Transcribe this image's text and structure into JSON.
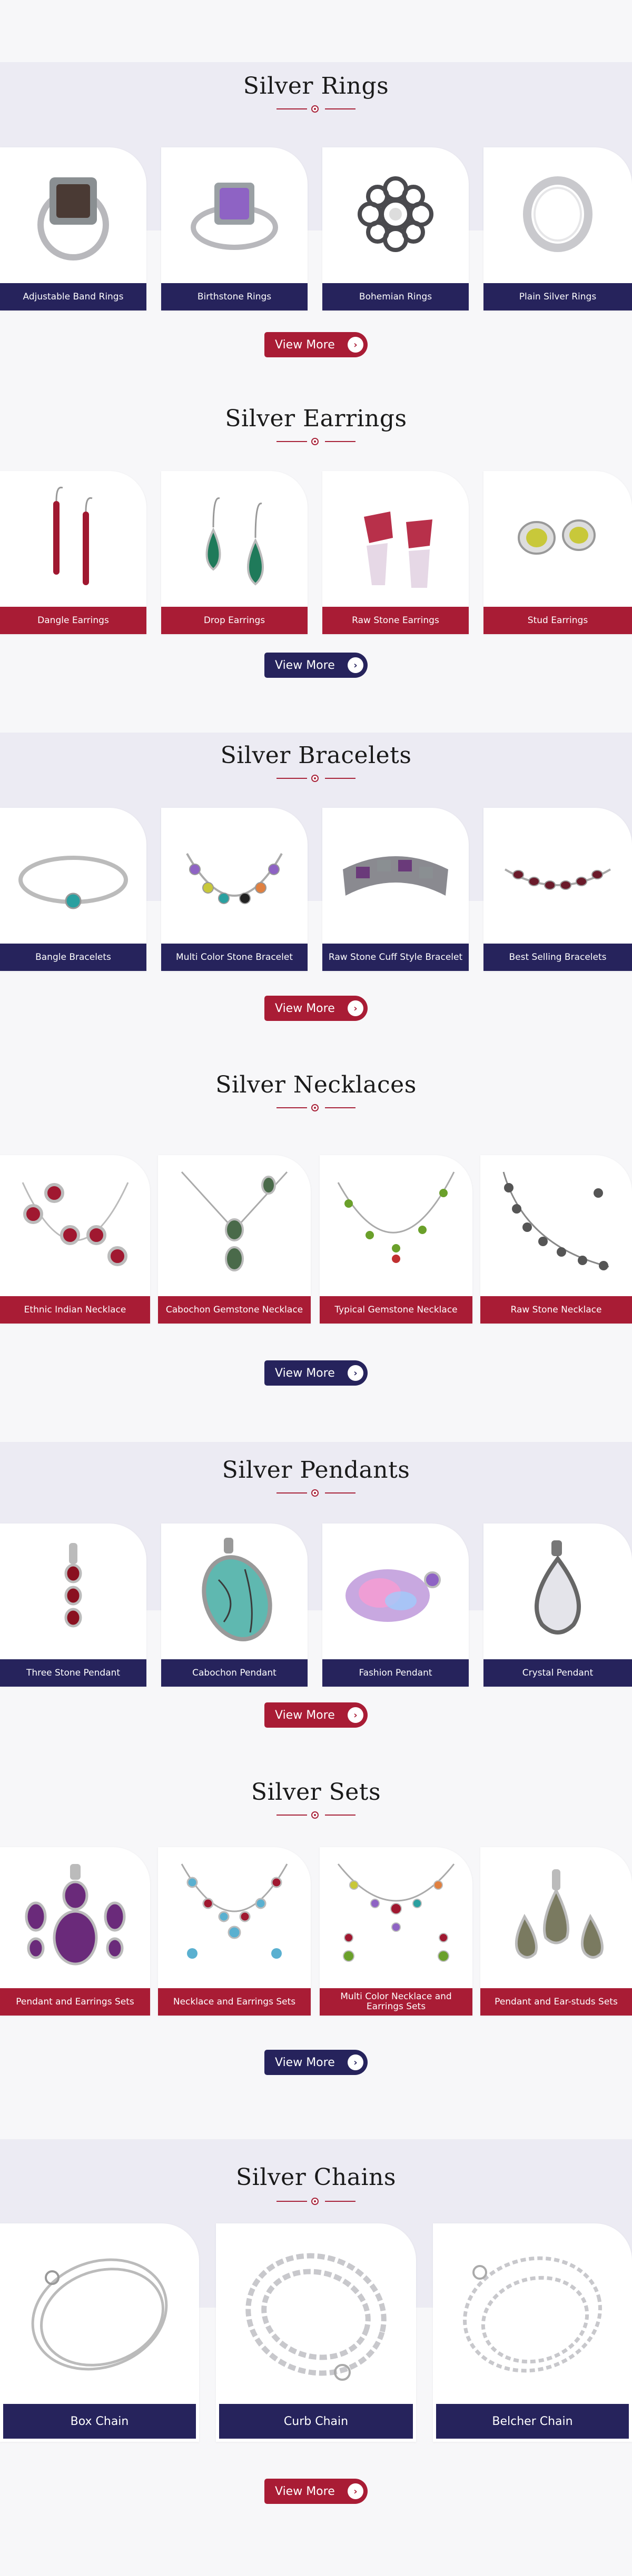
{
  "colors": {
    "navy": "#26235c",
    "red": "#a91c35",
    "band": "#ecebf3",
    "accent": "#a8233a"
  },
  "view_more_label": "View More",
  "sections": [
    {
      "title": "Silver Rings",
      "items": [
        "Adjustable Band Rings",
        "Birthstone Rings",
        "Bohemian Rings",
        "Plain Silver Rings"
      ]
    },
    {
      "title": "Silver Earrings",
      "items": [
        "Dangle Earrings",
        "Drop Earrings",
        "Raw Stone Earrings",
        "Stud Earrings"
      ]
    },
    {
      "title": "Silver Bracelets",
      "items": [
        "Bangle Bracelets",
        "Multi Color Stone Bracelet",
        "Raw Stone Cuff Style Bracelet",
        "Best Selling Bracelets"
      ]
    },
    {
      "title": "Silver Necklaces",
      "items": [
        "Ethnic Indian Necklace",
        "Cabochon Gemstone Necklace",
        "Typical Gemstone Necklace",
        "Raw Stone Necklace"
      ]
    },
    {
      "title": "Silver Pendants",
      "items": [
        "Three Stone Pendant",
        "Cabochon Pendant",
        "Fashion Pendant",
        "Crystal Pendant"
      ]
    },
    {
      "title": "Silver Sets",
      "items": [
        "Pendant and Earrings Sets",
        "Necklace and Earrings Sets",
        "Multi Color Necklace and Earrings Sets",
        "Pendant and Ear-studs Sets"
      ]
    },
    {
      "title": "Silver Chains",
      "items": [
        "Box Chain",
        "Curb Chain",
        "Belcher Chain"
      ]
    }
  ]
}
